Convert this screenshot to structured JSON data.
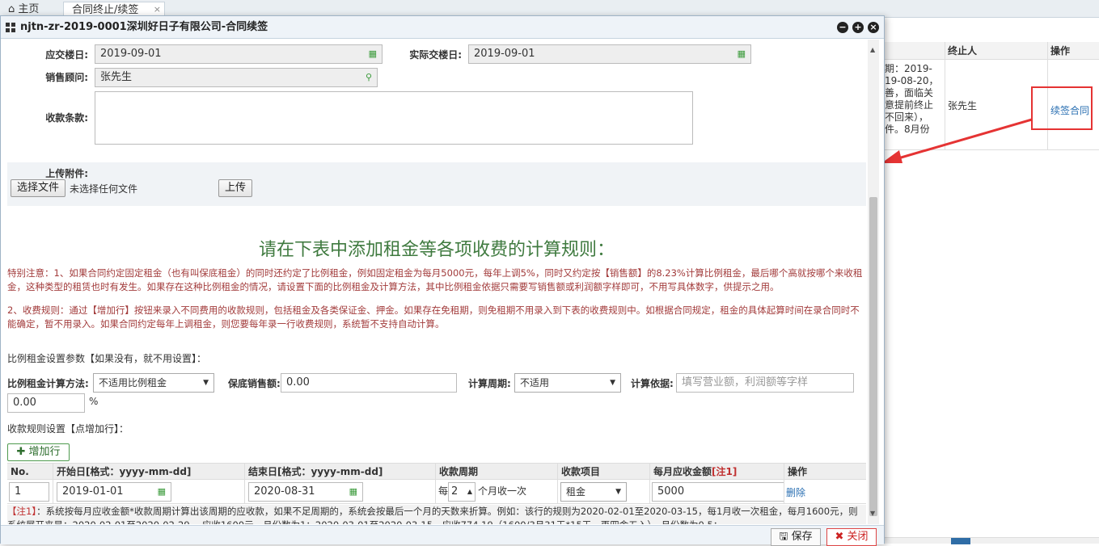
{
  "tabs": {
    "home": "主页",
    "active": "合同终止/续签",
    "close": "×"
  },
  "background_table": {
    "col_terminator": "终止人",
    "col_action": "操作",
    "remark_fragment": "期：2019-\n19-08-20，\n善，面临关\n意提前终止\n不回来），\n件。8月份",
    "person": "张先生",
    "renew_link": "续签合同"
  },
  "dialog": {
    "title": "njtn-zr-2019-0001深圳好日子有限公司-合同续签",
    "due_handover_label": "应交楼日:",
    "due_handover_value": "2019-09-01",
    "actual_handover_label": "实际交楼日:",
    "actual_handover_value": "2019-09-01",
    "advisor_label": "销售顾问:",
    "advisor_value": "张先生",
    "payment_terms_label": "收款条款:",
    "payment_terms_value": "",
    "upload_label": "上传附件:",
    "choose_file_button": "选择文件",
    "no_file_text": "未选择任何文件",
    "upload_button": "上传",
    "heading": "请在下表中添加租金等各项收费的计算规则：",
    "note1": "特别注意：1、如果合同约定固定租金（也有叫保底租金）的同时还约定了比例租金，例如固定租金为每月5000元，每年上调5%，同时又约定按【销售额】的8.23%计算比例租金，最后哪个高就按哪个来收租金，这种类型的租赁也时有发生。如果存在这种比例租金的情况，请设置下面的比例租金及计算方法，其中比例租金依据只需要写销售额或利润额字样即可，不用写具体数字，供提示之用。",
    "note2": "2、收费规则：通过【增加行】按钮来录入不同费用的收款规则，包括租金及各类保证金、押金。如果存在免租期，则免租期不用录入到下表的收费规则中。如根据合同规定，租金的具体起算时间在录合同时不能确定，暂不用录入。如果合同约定每年上调租金，则您要每年录一行收费规则，系统暂不支持自动计算。",
    "ratio_section_title": "比例租金设置参数【如果没有，就不用设置】：",
    "ratio_method_label": "比例租金计算方法:",
    "ratio_method_value": "不适用比例租金",
    "min_sales_label": "保底销售额:",
    "min_sales_value": "0.00",
    "calc_period_label": "计算周期:",
    "calc_period_value": "不适用",
    "calc_basis_label": "计算依据:",
    "calc_basis_placeholder": "填写营业额，利润额等字样",
    "ratio_value": "0.00",
    "ratio_unit": "%",
    "rules_section_title": "收款规则设置【点增加行】：",
    "add_row_button": "增加行",
    "table_headers": {
      "no": "No.",
      "start": "开始日[格式：yyyy-mm-dd]",
      "end": "结束日[格式：yyyy-mm-dd]",
      "cycle": "收款周期",
      "item": "收款项目",
      "amount": "每月应收金额",
      "amount_note": "[注1]",
      "action": "操作"
    },
    "row": {
      "no": "1",
      "start": "2019-01-01",
      "end": "2020-08-31",
      "cycle_prefix": "每",
      "cycle_value": "2",
      "cycle_suffix": "个月收一次",
      "item": "租金",
      "amount": "5000",
      "delete": "删除"
    },
    "footnote_tag": "【注1】",
    "footnote_text": "：系统按每月应收金额*收款周期计算出该周期的应收款，如果不足周期的，系统会按最后一个月的天数来折算。例如：该行的规则为2020-02-01至2020-03-15，每1月收一次租金，每月1600元，则系统展开来是：2020-02-01至2020-02-29 ，应收1600元，月份数为1；2020-03-01至2020-03-15，应收774.19（1600/3月31天*15天，再四舍五入），月份数为0.5；",
    "save_button": "保存",
    "close_button": "关闭"
  },
  "colors": {
    "accent_red": "#e53333",
    "heading_green": "#3f7a3f",
    "note_red": "#a23b3b",
    "link_blue": "#2a6fb2"
  }
}
